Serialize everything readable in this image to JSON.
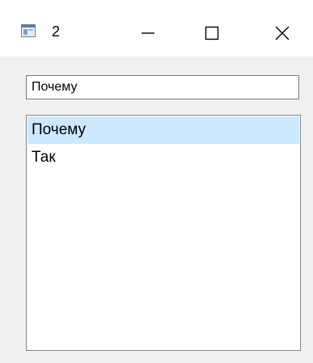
{
  "window": {
    "title": "2",
    "buttons": {
      "minimize_icon": "minimize-icon",
      "maximize_icon": "maximize-icon",
      "close_icon": "close-icon"
    }
  },
  "search": {
    "value": "Почему"
  },
  "list": {
    "items": [
      {
        "label": "Почему",
        "selected": true
      },
      {
        "label": "Так",
        "selected": false
      }
    ]
  },
  "colors": {
    "selection": "#cce8ff",
    "window_bg": "#f0f0f0",
    "titlebar_bg": "#ffffff"
  }
}
